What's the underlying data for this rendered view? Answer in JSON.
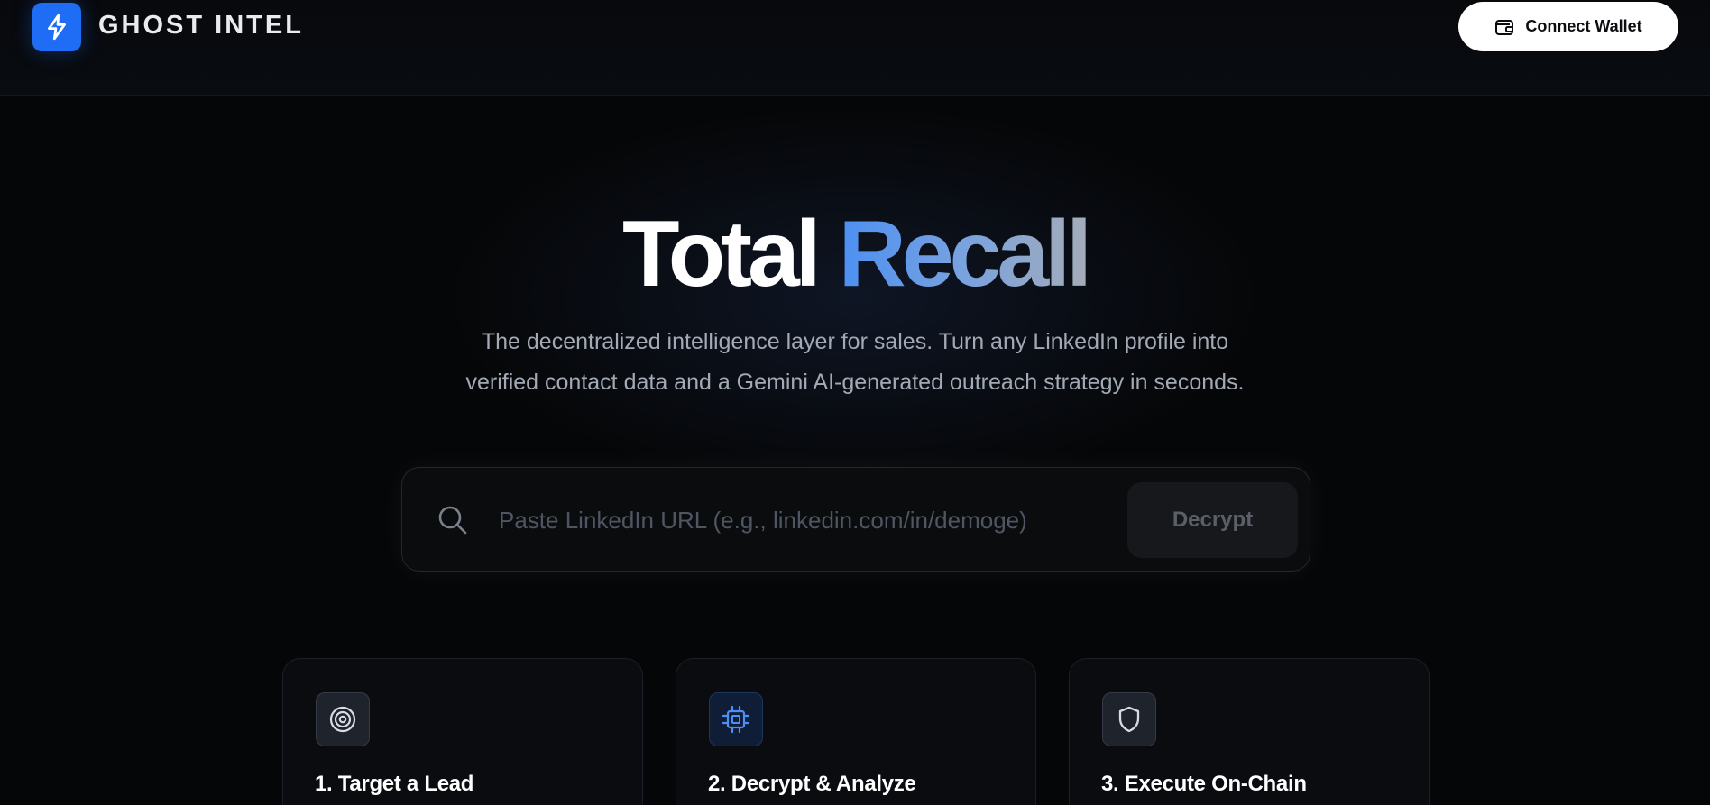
{
  "header": {
    "brand": "GHOST INTEL",
    "logo_icon": "lightning-bolt-icon",
    "connect_wallet_label": "Connect Wallet",
    "wallet_icon": "wallet-icon"
  },
  "hero": {
    "title_part1": "Total",
    "title_part2": "Recall",
    "subtitle_line1": "The decentralized intelligence layer for sales. Turn any LinkedIn profile into",
    "subtitle_line2": "verified contact data and a Gemini AI-generated outreach strategy in seconds."
  },
  "search": {
    "placeholder": "Paste LinkedIn URL (e.g., linkedin.com/in/demoge)",
    "value": "",
    "button_label": "Decrypt"
  },
  "steps": [
    {
      "title": "1. Target a Lead",
      "icon": "target-icon"
    },
    {
      "title": "2. Decrypt & Analyze",
      "icon": "cpu-chip-icon"
    },
    {
      "title": "3. Execute On-Chain",
      "icon": "shield-icon"
    }
  ],
  "colors": {
    "accent": "#1f6cf5",
    "gradient_start": "#4c8ff2",
    "gradient_end": "#a4acb8",
    "background": "#050607"
  }
}
